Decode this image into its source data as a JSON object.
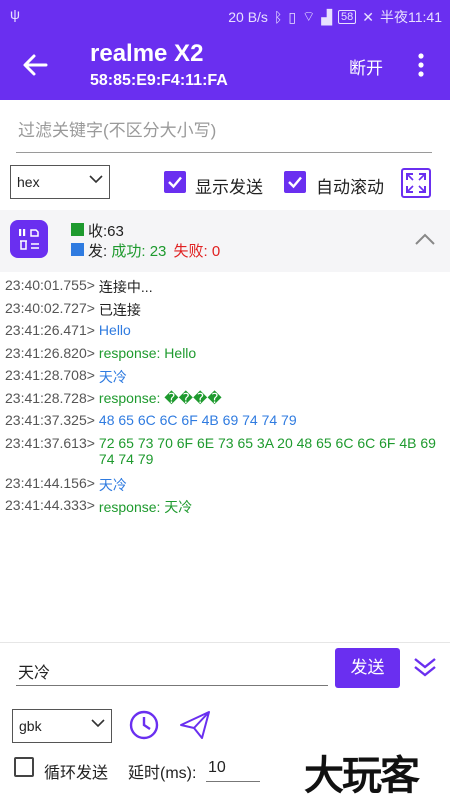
{
  "statusbar": {
    "speed": "20 B/s",
    "battery": "58",
    "time": "半夜11:41"
  },
  "appbar": {
    "title": "realme X2",
    "mac": "58:85:E9:F4:11:FA",
    "disconnect_label": "断开"
  },
  "filter": {
    "placeholder": "过滤关键字(不区分大小写)"
  },
  "controls": {
    "encoding_selected": "hex",
    "show_send_label": "显示发送",
    "auto_scroll_label": "自动滚动"
  },
  "stats": {
    "recv_label": "收:",
    "recv_count": "63",
    "send_label": "发:",
    "success_label": "成功:",
    "success_count": "23",
    "fail_label": "失败:",
    "fail_count": "0"
  },
  "colors": {
    "accent": "#6a2ff0",
    "recv_green": "#1e9a2e",
    "send_blue": "#2f7be0",
    "fail_red": "#e02020"
  },
  "log": [
    {
      "ts": "23:40:01.755>",
      "msg": "连接中...",
      "kind": "sys"
    },
    {
      "ts": "23:40:02.727>",
      "msg": "已连接",
      "kind": "sys"
    },
    {
      "ts": "23:41:26.471>",
      "msg": "Hello",
      "kind": "send"
    },
    {
      "ts": "23:41:26.820>",
      "msg": "response: Hello",
      "kind": "recv"
    },
    {
      "ts": "23:41:28.708>",
      "msg": "天冷",
      "kind": "send"
    },
    {
      "ts": "23:41:28.728>",
      "msg": "response: ����",
      "kind": "recv"
    },
    {
      "ts": "23:41:37.325>",
      "msg": "48 65 6C 6C 6F 4B 69 74 74 79",
      "kind": "send"
    },
    {
      "ts": "23:41:37.613>",
      "msg": "72 65 73 70 6F 6E 73 65 3A 20 48 65 6C 6C 6F 4B 69 74 74 79",
      "kind": "recv"
    },
    {
      "ts": "23:41:44.156>",
      "msg": "天冷",
      "kind": "send"
    },
    {
      "ts": "23:41:44.333>",
      "msg": "response: 天冷",
      "kind": "recv"
    }
  ],
  "bottom": {
    "send_value": "天冷",
    "send_label": "发送",
    "charset_selected": "gbk",
    "loop_label": "循环发送",
    "delay_label": "延时(ms):",
    "delay_value": "10",
    "watermark": "大玩客"
  }
}
